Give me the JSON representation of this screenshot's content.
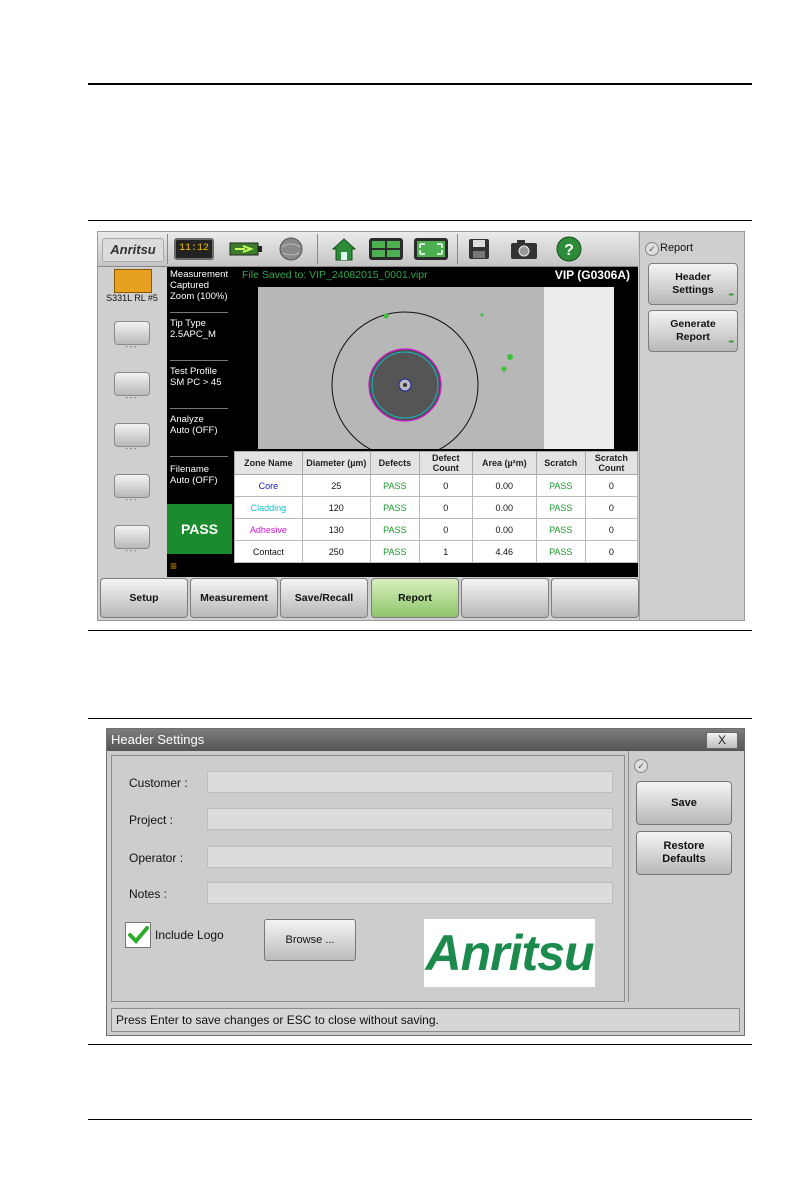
{
  "screen1": {
    "brand": "Anritsu",
    "clock": "11:12",
    "device_label": "S331L RL #5",
    "side_dash": "- - -",
    "info": {
      "measurement_title": "Measurement",
      "measurement_status": "Captured",
      "zoom": "Zoom (100%)",
      "tip_type_label": "Tip Type",
      "tip_type_value": "2.5APC_M",
      "test_profile_label": "Test Profile",
      "test_profile_value": "SM PC > 45",
      "analyze_label": "Analyze",
      "analyze_value": "Auto (OFF)",
      "filename_label": "Filename",
      "filename_value": "Auto (OFF)",
      "overall_result": "PASS"
    },
    "file_saved": "File Saved to: VIP_24082015_0001.vipr",
    "model": "VIP (G0306A)",
    "table": {
      "headers": [
        "Zone Name",
        "Diameter (µm)",
        "Defects",
        "Defect Count",
        "Area (µ²m)",
        "Scratch",
        "Scratch Count"
      ],
      "rows": [
        {
          "zone": "Core",
          "zone_color": "#1a1aa8",
          "diameter": "25",
          "defects": "PASS",
          "defect_count": "0",
          "area": "0.00",
          "scratch": "PASS",
          "scratch_count": "0"
        },
        {
          "zone": "Cladding",
          "zone_color": "#19b9c9",
          "diameter": "120",
          "defects": "PASS",
          "defect_count": "0",
          "area": "0.00",
          "scratch": "PASS",
          "scratch_count": "0"
        },
        {
          "zone": "Adhesive",
          "zone_color": "#d01ad0",
          "diameter": "130",
          "defects": "PASS",
          "defect_count": "0",
          "area": "0.00",
          "scratch": "PASS",
          "scratch_count": "0"
        },
        {
          "zone": "Contact",
          "zone_color": "#111111",
          "diameter": "250",
          "defects": "PASS",
          "defect_count": "1",
          "area": "4.46",
          "scratch": "PASS",
          "scratch_count": "0"
        }
      ]
    },
    "bottom_tabs": [
      "Setup",
      "Measurement",
      "Save/Recall",
      "Report",
      "",
      ""
    ],
    "active_tab": "Report",
    "right_panel": {
      "title": "Report",
      "header_settings_1": "Header",
      "header_settings_2": "Settings",
      "generate_report_1": "Generate",
      "generate_report_2": "Report"
    },
    "colors": {
      "pass_green": "#1a8c2e",
      "saved_text": "#2fa84a",
      "active_tab": "#8ec56a"
    }
  },
  "dialog": {
    "title": "Header Settings",
    "close_label": "X",
    "fields": {
      "customer_label": "Customer :",
      "customer_value": "",
      "project_label": "Project :",
      "project_value": "",
      "operator_label": "Operator :",
      "operator_value": "",
      "notes_label": "Notes :",
      "notes_value": ""
    },
    "include_logo_label": "Include Logo",
    "include_logo_checked": true,
    "browse_label": "Browse ...",
    "logo_text": "Anritsu",
    "save_label": "Save",
    "restore_1": "Restore",
    "restore_2": "Defaults",
    "status": "Press Enter to save changes or ESC to close without saving.",
    "colors": {
      "logo_green": "#1b8a4c",
      "checkmark": "#2faa2f"
    }
  }
}
